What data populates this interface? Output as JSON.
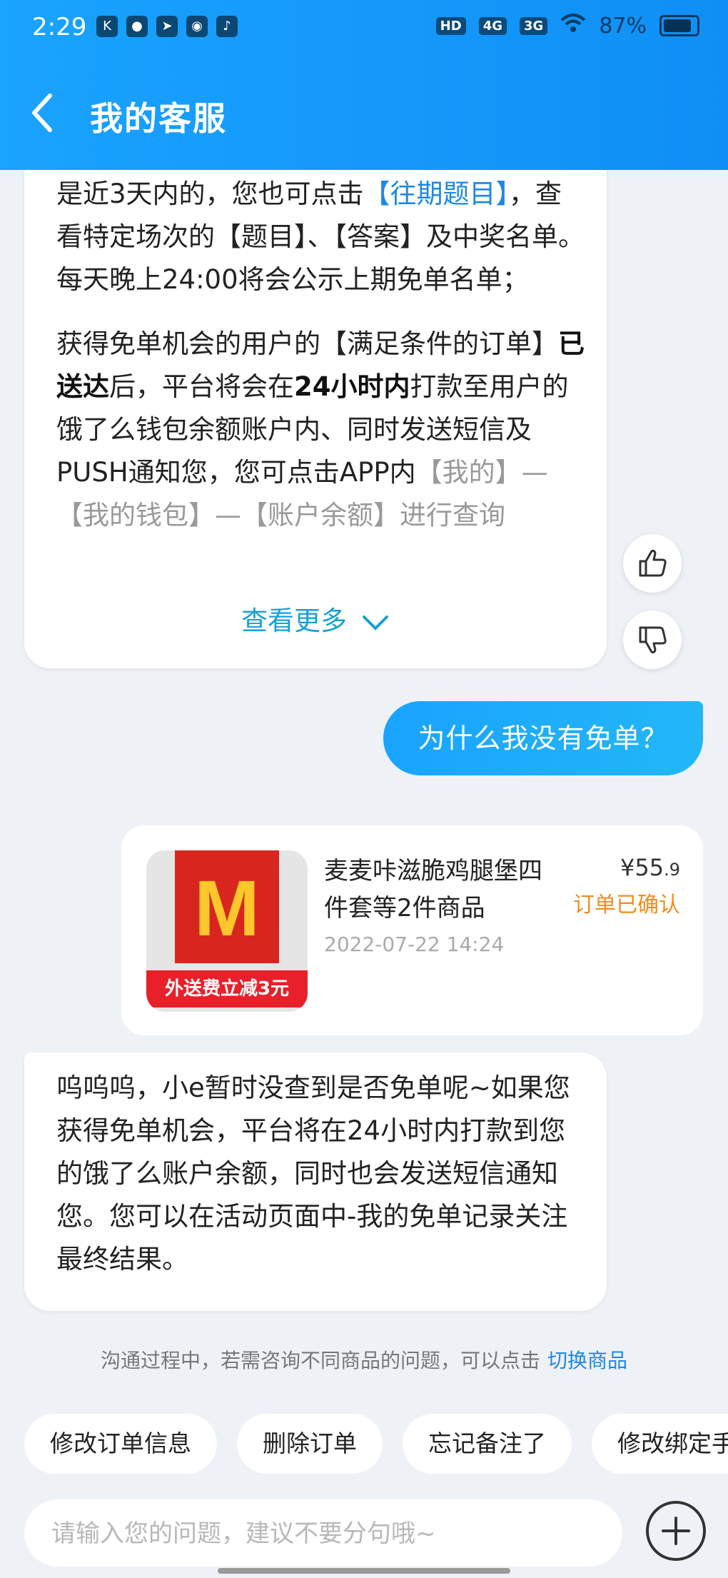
{
  "status_bar": {
    "time": "2:29",
    "signal_1": "4G",
    "signal_2": "3G",
    "battery": "87%"
  },
  "header": {
    "title": "我的客服"
  },
  "bot_message_1": {
    "p1_a": "是近3天内的，您也可点击",
    "p1_link": "【往期题目】",
    "p1_b": "，查看特定场次的【题目】、【答案】及中奖名单。每天晚上24:00将会公示上期免单名单；",
    "p2_a": "获得免单机会的用户的【满足条件的订单】",
    "p2_bold1": "已送达",
    "p2_b": "后，平台将会在",
    "p2_bold2": "24小时内",
    "p2_c": "打款至用户的饿了么钱包余额账户内、同时发送短信及PUSH通知您，您可点击APP内",
    "p2_faded": "【我的】—【我的钱包】—【账户余额】进行查询",
    "more_label": "查看更多"
  },
  "user_message": {
    "text": "为什么我没有免单？"
  },
  "order_card": {
    "product_name": "麦麦咔滋脆鸡腿堡四件套等2件商品",
    "thumb_ribbon": "外送费立减3元",
    "price_symbol": "¥",
    "price_main": "55",
    "price_decimal": ".9",
    "status": "订单已确认",
    "time": "2022-07-22 14:24"
  },
  "bot_message_2": {
    "text": "呜呜呜，小e暂时没查到是否免单呢~如果您获得免单机会，平台将在24小时内打款到您的饿了么账户余额，同时也会发送短信通知您。您可以在活动页面中-我的免单记录关注最终结果。"
  },
  "hint": {
    "text": "沟通过程中，若需咨询不同商品的问题，可以点击",
    "link": "切换商品"
  },
  "quick_replies": [
    "修改订单信息",
    "删除订单",
    "忘记备注了",
    "修改绑定手"
  ],
  "input": {
    "placeholder": "请输入您的问题，建议不要分句哦~"
  },
  "colors": {
    "header_blue": "#0f8ff5",
    "link_blue": "#1e88e5",
    "order_status_orange": "#f08c1e"
  }
}
